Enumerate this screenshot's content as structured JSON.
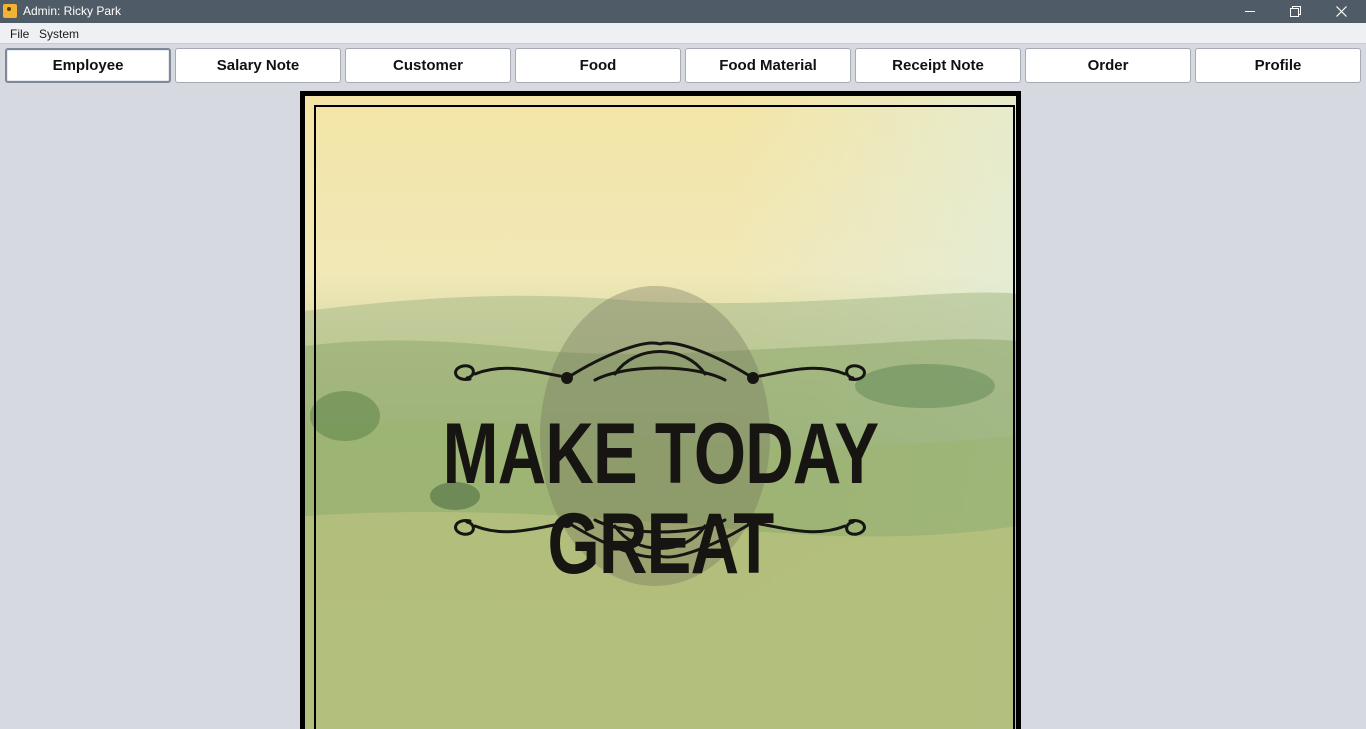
{
  "window": {
    "title": "Admin: Ricky Park"
  },
  "menu": {
    "items": [
      "File",
      "System"
    ]
  },
  "nav": {
    "buttons": [
      "Employee",
      "Salary Note",
      "Customer",
      "Food",
      "Food Material",
      "Receipt Note",
      "Order",
      "Profile"
    ],
    "active": "Employee"
  },
  "poster": {
    "text": "MAKE TODAY GREAT"
  },
  "colors": {
    "titlebar": "#4f5b66",
    "background": "#d6d9e0",
    "button": "#ffffff"
  }
}
